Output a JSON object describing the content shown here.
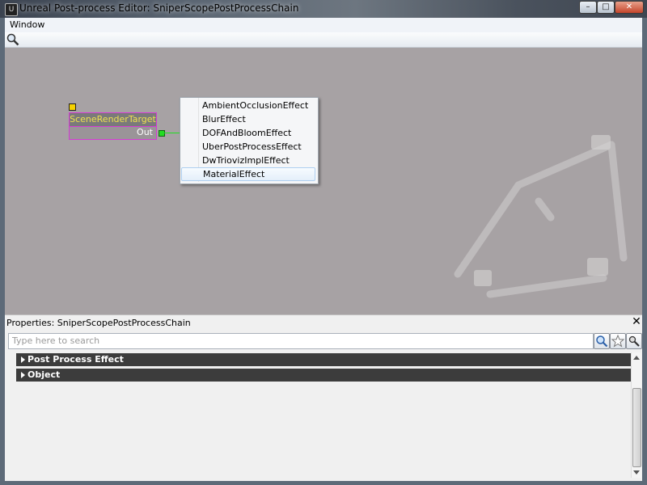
{
  "window": {
    "title": "Unreal Post-process Editor: SniperScopePostProcessChain",
    "controls": {
      "minimize": "–",
      "maximize": "□",
      "close": "✕"
    }
  },
  "menu": {
    "items": [
      "Window"
    ]
  },
  "toolbar": {
    "icon": "zoom-icon"
  },
  "canvas": {
    "node": {
      "title": "SceneRenderTarget",
      "output_label": "Out"
    },
    "context_menu": {
      "items": [
        "AmbientOcclusionEffect",
        "BlurEffect",
        "DOFAndBloomEffect",
        "UberPostProcessEffect",
        "DwTriovizImplEffect",
        "MaterialEffect"
      ],
      "highlighted_index": 5
    }
  },
  "properties": {
    "title": "Properties: SniperScopePostProcessChain",
    "close": "✕",
    "search_placeholder": "Type here to search",
    "search_buttons": [
      "search-icon",
      "favorite-star-icon",
      "settings-icon"
    ],
    "groups": [
      "Post Process Effect",
      "Object"
    ]
  },
  "colors": {
    "canvas_bg": "#a7a2a4",
    "node_border": "#d43ad4",
    "node_title_text": "#f0e050",
    "connector_green": "#22dd22",
    "group_header_bg": "#3c3c3c"
  }
}
